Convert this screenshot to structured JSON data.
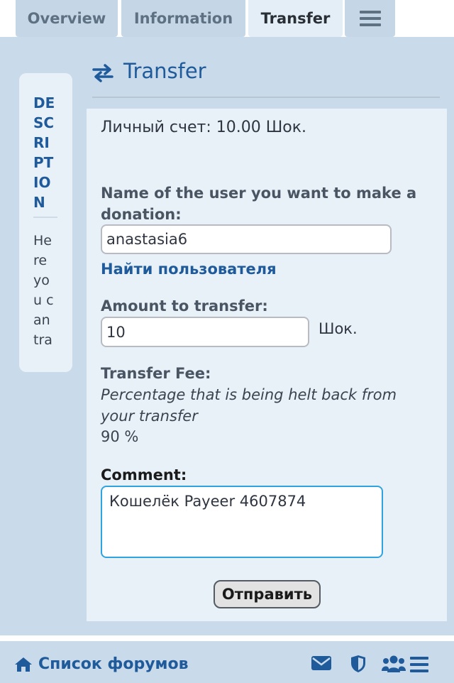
{
  "tabs": [
    {
      "label": "Overview"
    },
    {
      "label": "Information"
    },
    {
      "label": "Transfer"
    }
  ],
  "menu_icon": "hamburger-icon",
  "sidebar": {
    "title": "DESCRIPTION",
    "text": "Here you can tra"
  },
  "header": {
    "title": "Transfer",
    "icon": "transfer-arrows-icon"
  },
  "form": {
    "balance": "Личный счет: 10.00 Шок.",
    "recipient_label": "Name of the user you want to make a donation:",
    "recipient_value": "anastasia6",
    "find_user_link": "Найти пользователя",
    "amount_label": "Amount to transfer:",
    "amount_value": "10",
    "amount_unit": "Шок.",
    "fee_label": "Transfer Fee:",
    "fee_description": "Percentage that is being helt back from your transfer",
    "fee_value": "90 %",
    "comment_label": "Comment:",
    "comment_value": "Кошелёк Payeer 4607874",
    "submit_label": "Отправить"
  },
  "footer": {
    "forum_list": "Список форумов",
    "icons": [
      "envelope-icon",
      "shield-icon",
      "users-icon",
      "hamburger-icon"
    ]
  },
  "colors": {
    "accent": "#1f5a9a",
    "tab_bg": "#c5d6e6",
    "page_bg": "#c9daea",
    "panel_bg": "#e9f1f8",
    "focus_border": "#2fa3e0"
  }
}
